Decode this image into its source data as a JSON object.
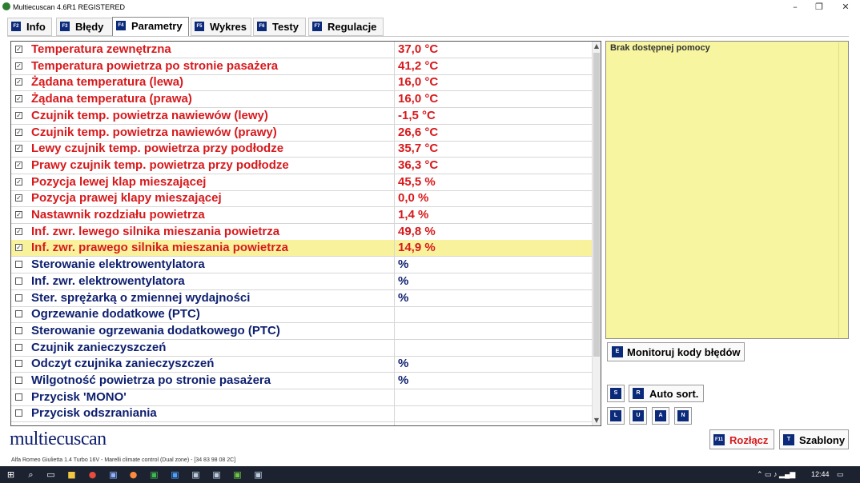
{
  "window": {
    "title": "Multiecuscan 4.6R1 REGISTERED",
    "min": "–",
    "max": "❐",
    "close": "✕"
  },
  "tabs": [
    {
      "key": "F2",
      "label": "Info"
    },
    {
      "key": "F3",
      "label": "Błędy"
    },
    {
      "key": "F4",
      "label": "Parametry"
    },
    {
      "key": "F5",
      "label": "Wykres"
    },
    {
      "key": "F6",
      "label": "Testy"
    },
    {
      "key": "F7",
      "label": "Regulacje"
    }
  ],
  "params": [
    {
      "name": "Temperatura zewnętrzna",
      "value": "37,0 °C",
      "checked": true
    },
    {
      "name": "Temperatura powietrza po stronie pasażera",
      "value": "41,2 °C",
      "checked": true
    },
    {
      "name": "Żądana temperatura (lewa)",
      "value": "16,0 °C",
      "checked": true
    },
    {
      "name": "Żądana temperatura (prawa)",
      "value": "16,0 °C",
      "checked": true
    },
    {
      "name": "Czujnik temp. powietrza nawiewów (lewy)",
      "value": "-1,5 °C",
      "checked": true
    },
    {
      "name": "Czujnik temp. powietrza nawiewów (prawy)",
      "value": "26,6 °C",
      "checked": true
    },
    {
      "name": "Lewy czujnik temp. powietrza przy podłodze",
      "value": "35,7 °C",
      "checked": true
    },
    {
      "name": "Prawy czujnik temp. powietrza przy podłodze",
      "value": "36,3 °C",
      "checked": true
    },
    {
      "name": "Pozycja lewej klap mieszającej",
      "value": "45,5 %",
      "checked": true
    },
    {
      "name": "Pozycja prawej klapy mieszającej",
      "value": "0,0 %",
      "checked": true
    },
    {
      "name": "Nastawnik rozdziału powietrza",
      "value": "1,4 %",
      "checked": true
    },
    {
      "name": "Inf. zwr. lewego silnika mieszania powietrza",
      "value": "49,8 %",
      "checked": true
    },
    {
      "name": "Inf. zwr. prawego silnika mieszania powietrza",
      "value": "14,9 %",
      "checked": true,
      "selected": true
    },
    {
      "name": "Sterowanie elektrowentylatora",
      "value": " %",
      "checked": false
    },
    {
      "name": "Inf. zwr. elektrowentylatora",
      "value": " %",
      "checked": false
    },
    {
      "name": "Ster. sprężarką o zmiennej wydajności",
      "value": " %",
      "checked": false
    },
    {
      "name": "Ogrzewanie dodatkowe (PTC)",
      "value": "",
      "checked": false
    },
    {
      "name": "Sterowanie ogrzewania dodatkowego (PTC)",
      "value": "",
      "checked": false
    },
    {
      "name": "Czujnik zanieczyszczeń",
      "value": "",
      "checked": false
    },
    {
      "name": "Odczyt czujnika zanieczyszczeń",
      "value": " %",
      "checked": false
    },
    {
      "name": "Wilgotność powietrza po stronie pasażera",
      "value": " %",
      "checked": false
    },
    {
      "name": "Przycisk 'MONO'",
      "value": "",
      "checked": false
    },
    {
      "name": "Przycisk odszraniania",
      "value": "",
      "checked": false
    }
  ],
  "help": {
    "text": "Brak dostępnej pomocy"
  },
  "buttons": {
    "monitor": {
      "key": "E",
      "label": "Monitoruj kody błędów"
    },
    "s": {
      "key": "S"
    },
    "autosort": {
      "key": "R",
      "label": "Auto sort."
    },
    "l": {
      "key": "L"
    },
    "u": {
      "key": "U"
    },
    "a": {
      "key": "A"
    },
    "n": {
      "key": "N"
    },
    "disconnect": {
      "key": "F11",
      "label": "Rozłącz"
    },
    "templates": {
      "key": "T",
      "label": "Szablony"
    }
  },
  "logo": "multiecuscan",
  "status": "Alfa Romeo Giulietta 1.4 Turbo 16V - Marelli climate control (Dual zone) - [34 83 98 08 2C]",
  "taskbar": {
    "time": "12:44"
  }
}
